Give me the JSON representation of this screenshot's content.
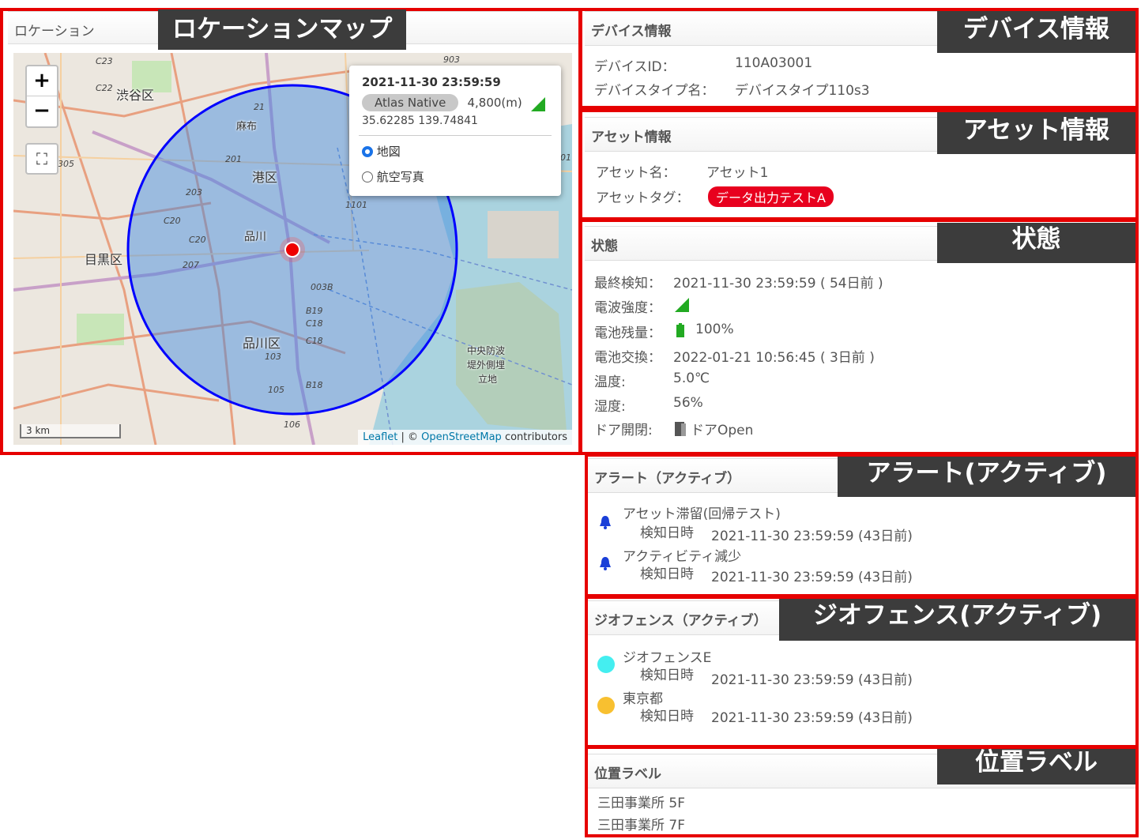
{
  "location": {
    "panel_title": "ロケーション",
    "tag": "ロケーションマップ",
    "zoom_in": "+",
    "zoom_out": "−",
    "fullscreen_glyph": "⛶",
    "map_labels": [
      "渋谷区",
      "麻布",
      "港区",
      "品川",
      "目黒区",
      "品川区",
      "中央防波",
      "堤外側埋",
      "立地"
    ],
    "route_numbers": [
      "C23",
      "C22",
      "305",
      "201",
      "203",
      "C20",
      "C20",
      "207",
      "21",
      "1101",
      "003B",
      "B19",
      "C18",
      "C18",
      "103",
      "105",
      "B18",
      "106",
      "903",
      "01"
    ],
    "popup": {
      "timestamp": "2021-11-30 23:59:59",
      "source": "Atlas Native",
      "accuracy": "4,800(m)",
      "coords": "35.62285 139.74841",
      "layer_map": "地図",
      "layer_aerial": "航空写真"
    },
    "scale": "3 km",
    "attribution_leaflet": "Leaflet",
    "attribution_sep": " | © ",
    "attribution_osm": "OpenStreetMap",
    "attribution_tail": " contributors"
  },
  "device": {
    "panel_title": "デバイス情報",
    "tag": "デバイス情報",
    "id_label": "デバイスID：",
    "id_value": "110A03001",
    "type_label": "デバイスタイプ名：",
    "type_value": "デバイスタイプ110s3"
  },
  "asset": {
    "panel_title": "アセット情報",
    "tag": "アセット情報",
    "name_label": "アセット名：",
    "name_value": "アセット1",
    "tag_label": "アセットタグ：",
    "tag_value": "データ出力テストA"
  },
  "status": {
    "panel_title": "状態",
    "tag": "状態",
    "last_detect_label": "最終検知：",
    "last_detect_value": "2021-11-30 23:59:59 ( 54日前 )",
    "signal_label": "電波強度：",
    "battery_label": "電池残量：",
    "battery_value": "100%",
    "battery_change_label": "電池交換：",
    "battery_change_value": "2022-01-21 10:56:45 ( 3日前 )",
    "temp_label": "温度:",
    "temp_value": "5.0℃",
    "humidity_label": "湿度:",
    "humidity_value": "56%",
    "door_label": "ドア開閉:",
    "door_value": "ドアOpen",
    "colors": {
      "signal": "#22aa22",
      "battery": "#22aa22"
    }
  },
  "alerts": {
    "panel_title": "アラート（アクティブ）",
    "tag": "アラート(アクティブ)",
    "items": [
      {
        "name": "アセット滞留(回帰テスト)",
        "detect_label": "検知日時",
        "detect_value": "2021-11-30 23:59:59 (43日前)"
      },
      {
        "name": "アクティビティ減少",
        "detect_label": "検知日時",
        "detect_value": "2021-11-30 23:59:59 (43日前)"
      }
    ]
  },
  "geofence": {
    "panel_title": "ジオフェンス（アクティブ）",
    "tag": "ジオフェンス(アクティブ)",
    "items": [
      {
        "name": "ジオフェンスE",
        "detect_label": "検知日時",
        "detect_value": "2021-11-30 23:59:59 (43日前)",
        "color": "#44eef0"
      },
      {
        "name": "東京都",
        "detect_label": "検知日時",
        "detect_value": "2021-11-30 23:59:59 (43日前)",
        "color": "#f8c030"
      }
    ]
  },
  "position_labels": {
    "panel_title": "位置ラベル",
    "tag": "位置ラベル",
    "items": [
      "三田事業所 5F",
      "三田事業所 7F"
    ]
  }
}
